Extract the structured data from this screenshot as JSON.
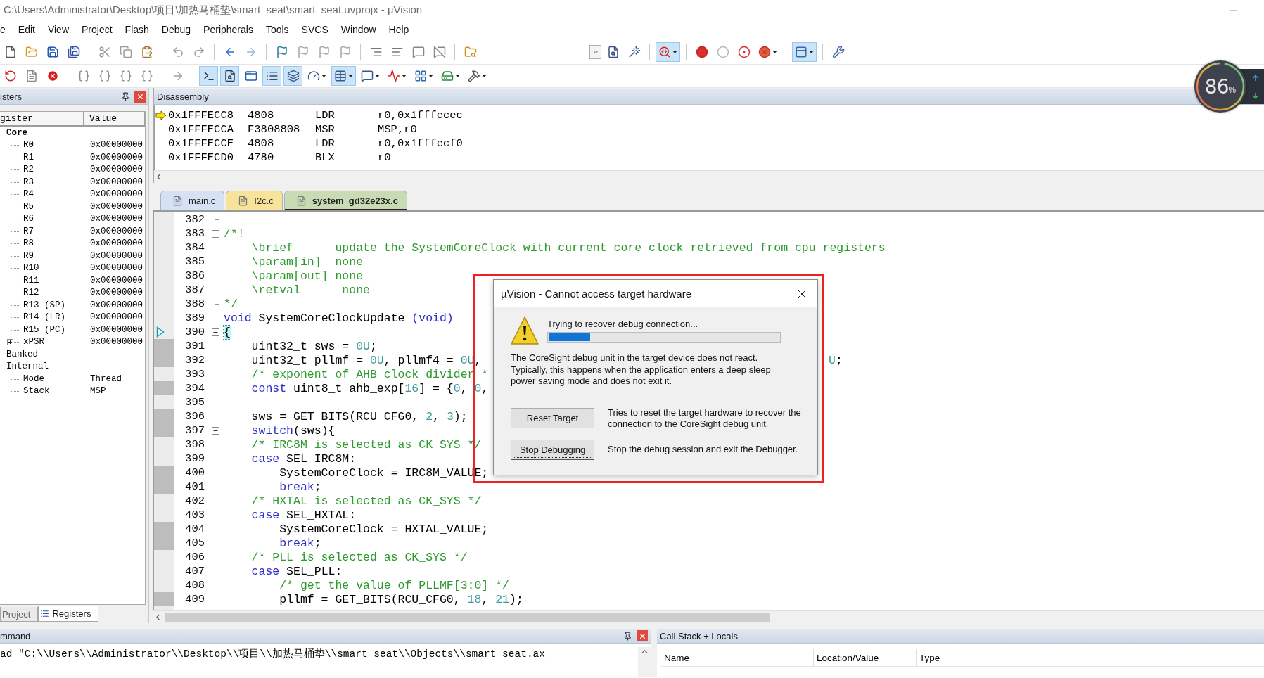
{
  "window": {
    "title": "C:\\Users\\Administrator\\Desktop\\项目\\加热马桶垫\\smart_seat\\smart_seat.uvprojx - µVision"
  },
  "menu": [
    "e",
    "Edit",
    "View",
    "Project",
    "Flash",
    "Debug",
    "Peripherals",
    "Tools",
    "SVCS",
    "Window",
    "Help"
  ],
  "toolbars": [
    {
      "items": [
        {
          "kind": "new",
          "pressed": false,
          "dropdown": false
        },
        {
          "kind": "open",
          "pressed": false,
          "dropdown": false
        },
        {
          "kind": "save",
          "pressed": false,
          "dropdown": false
        },
        {
          "kind": "save-all",
          "pressed": false,
          "dropdown": false
        },
        {
          "kind": "separator"
        },
        {
          "kind": "cut",
          "pressed": false,
          "dropdown": false
        },
        {
          "kind": "copy",
          "pressed": false,
          "dropdown": false
        },
        {
          "kind": "paste",
          "pressed": false,
          "dropdown": false
        },
        {
          "kind": "separator"
        },
        {
          "kind": "undo",
          "pressed": false,
          "dropdown": false
        },
        {
          "kind": "redo",
          "pressed": false,
          "dropdown": false
        },
        {
          "kind": "separator"
        },
        {
          "kind": "back",
          "pressed": false,
          "dropdown": false
        },
        {
          "kind": "forward",
          "pressed": false,
          "dropdown": false
        },
        {
          "kind": "separator"
        },
        {
          "kind": "bookmark",
          "pressed": false,
          "dropdown": false
        },
        {
          "kind": "bookmark-prev",
          "pressed": false,
          "dropdown": false
        },
        {
          "kind": "bookmark-next",
          "pressed": false,
          "dropdown": false
        },
        {
          "kind": "bookmark-clear",
          "pressed": false,
          "dropdown": false
        },
        {
          "kind": "separator"
        },
        {
          "kind": "indent",
          "pressed": false,
          "dropdown": false
        },
        {
          "kind": "outdent",
          "pressed": false,
          "dropdown": false
        },
        {
          "kind": "comment",
          "pressed": false,
          "dropdown": false
        },
        {
          "kind": "uncomment",
          "pressed": false,
          "dropdown": false
        },
        {
          "kind": "separator"
        },
        {
          "kind": "find-in-files",
          "pressed": false,
          "dropdown": false
        },
        {
          "kind": "spacer"
        },
        {
          "kind": "select-box"
        },
        {
          "kind": "find",
          "pressed": false,
          "dropdown": false
        },
        {
          "kind": "wand",
          "pressed": false,
          "dropdown": false
        },
        {
          "kind": "separator"
        },
        {
          "kind": "debug",
          "pressed": true,
          "dropdown": true
        },
        {
          "kind": "separator"
        },
        {
          "kind": "breakpoint",
          "pressed": false,
          "dropdown": false
        },
        {
          "kind": "breakpoint-off",
          "pressed": false,
          "dropdown": false
        },
        {
          "kind": "breakpoints-off",
          "pressed": false,
          "dropdown": false
        },
        {
          "kind": "breakpoints-kill",
          "pressed": false,
          "dropdown": true
        },
        {
          "kind": "separator"
        },
        {
          "kind": "window",
          "pressed": true,
          "dropdown": true
        },
        {
          "kind": "separator"
        },
        {
          "kind": "configure",
          "pressed": false,
          "dropdown": false
        }
      ]
    },
    {
      "items": [
        {
          "kind": "reset",
          "pressed": false,
          "dropdown": false
        },
        {
          "kind": "document",
          "pressed": false,
          "dropdown": false
        },
        {
          "kind": "stop",
          "pressed": false,
          "dropdown": false
        },
        {
          "kind": "separator"
        },
        {
          "kind": "step-into",
          "pressed": false,
          "dropdown": false
        },
        {
          "kind": "step-over",
          "pressed": false,
          "dropdown": false
        },
        {
          "kind": "step-out",
          "pressed": false,
          "dropdown": false
        },
        {
          "kind": "run-to-cursor",
          "pressed": false,
          "dropdown": false
        },
        {
          "kind": "separator"
        },
        {
          "kind": "next-statement",
          "pressed": false,
          "dropdown": false
        },
        {
          "kind": "separator"
        },
        {
          "kind": "command-window",
          "pressed": true,
          "dropdown": false
        },
        {
          "kind": "disassembly-window",
          "pressed": true,
          "dropdown": false
        },
        {
          "kind": "symbols-window",
          "pressed": false,
          "dropdown": false
        },
        {
          "kind": "registers-window",
          "pressed": true,
          "dropdown": false
        },
        {
          "kind": "call-stack-window",
          "pressed": true,
          "dropdown": false
        },
        {
          "kind": "watch-window",
          "pressed": false,
          "dropdown": true
        },
        {
          "kind": "memory-window",
          "pressed": true,
          "dropdown": true
        },
        {
          "kind": "serial-window",
          "pressed": false,
          "dropdown": true
        },
        {
          "kind": "analysis-window",
          "pressed": false,
          "dropdown": true
        },
        {
          "kind": "trace-window",
          "pressed": false,
          "dropdown": true
        },
        {
          "kind": "system-viewer",
          "pressed": false,
          "dropdown": true
        },
        {
          "kind": "toolbox",
          "pressed": false,
          "dropdown": true
        }
      ]
    }
  ],
  "registers": {
    "title": "isters",
    "columns": [
      "gister",
      "Value"
    ],
    "tree": [
      {
        "name": "Core",
        "emphasis": true,
        "children": [
          {
            "name": "R0",
            "value": "0x00000000"
          },
          {
            "name": "R1",
            "value": "0x00000000"
          },
          {
            "name": "R2",
            "value": "0x00000000"
          },
          {
            "name": "R3",
            "value": "0x00000000"
          },
          {
            "name": "R4",
            "value": "0x00000000"
          },
          {
            "name": "R5",
            "value": "0x00000000"
          },
          {
            "name": "R6",
            "value": "0x00000000"
          },
          {
            "name": "R7",
            "value": "0x00000000"
          },
          {
            "name": "R8",
            "value": "0x00000000"
          },
          {
            "name": "R9",
            "value": "0x00000000"
          },
          {
            "name": "R10",
            "value": "0x00000000"
          },
          {
            "name": "R11",
            "value": "0x00000000"
          },
          {
            "name": "R12",
            "value": "0x00000000"
          },
          {
            "name": "R13 (SP)",
            "value": "0x00000000"
          },
          {
            "name": "R14 (LR)",
            "value": "0x00000000"
          },
          {
            "name": "R15 (PC)",
            "value": "0x00000000"
          },
          {
            "name": "xPSR",
            "value": "0x00000000",
            "expanded": false
          }
        ]
      },
      {
        "name": "Banked",
        "emphasis": false
      },
      {
        "name": "Internal",
        "emphasis": false,
        "children": [
          {
            "name": "Mode",
            "value": "Thread"
          },
          {
            "name": "Stack",
            "value": "MSP"
          }
        ]
      }
    ]
  },
  "left_tabs": [
    {
      "label": "Project",
      "selected": false
    },
    {
      "label": "Registers",
      "selected": true
    }
  ],
  "disassembly": {
    "title": "Disassembly",
    "lines": [
      {
        "address": "0x1FFFECC8",
        "opcode": "4808",
        "mnemonic": "LDR",
        "operands": "r0,0x1fffecec",
        "current": true
      },
      {
        "address": "0x1FFFECCA",
        "opcode": "F3808808",
        "mnemonic": "MSR",
        "operands": "MSP,r0",
        "current": false
      },
      {
        "address": "0x1FFFECCE",
        "opcode": "4808",
        "mnemonic": "LDR",
        "operands": "r0,0x1fffecf0",
        "current": false
      },
      {
        "address": "0x1FFFECD0",
        "opcode": "4780",
        "mnemonic": "BLX",
        "operands": "r0",
        "current": false
      }
    ]
  },
  "editor_tabs": [
    {
      "label": "main.c",
      "selected": false,
      "color": "#d6e2f3"
    },
    {
      "label": "I2c.c",
      "selected": false,
      "color": "#f7e39a"
    },
    {
      "label": "system_gd32e23x.c",
      "selected": true,
      "color": "#c9dbb5"
    }
  ],
  "code": [
    {
      "n": "382",
      "fold_start": false,
      "fold_end": true,
      "executable": false,
      "current": false
    },
    {
      "n": "383",
      "fold_start": true,
      "fold_end": false,
      "executable": false,
      "current": false,
      "segs": [
        {
          "kind": "comment",
          "text": "/*!"
        }
      ]
    },
    {
      "n": "384",
      "fold_start": false,
      "fold_end": false,
      "executable": false,
      "current": false,
      "segs": [
        {
          "kind": "comment",
          "text": "    \\brief      update the SystemCoreClock with current core clock retrieved from cpu registers"
        }
      ]
    },
    {
      "n": "385",
      "fold_start": false,
      "fold_end": false,
      "executable": false,
      "current": false,
      "segs": [
        {
          "kind": "comment",
          "text": "    \\param[in]  none"
        }
      ]
    },
    {
      "n": "386",
      "fold_start": false,
      "fold_end": false,
      "executable": false,
      "current": false,
      "segs": [
        {
          "kind": "comment",
          "text": "    \\param[out] none"
        }
      ]
    },
    {
      "n": "387",
      "fold_start": false,
      "fold_end": false,
      "executable": false,
      "current": false,
      "segs": [
        {
          "kind": "comment",
          "text": "    \\retval      none"
        }
      ]
    },
    {
      "n": "388",
      "fold_start": false,
      "fold_end": true,
      "executable": false,
      "current": false,
      "segs": [
        {
          "kind": "comment",
          "text": "*/"
        }
      ]
    },
    {
      "n": "389",
      "fold_start": false,
      "fold_end": false,
      "executable": false,
      "current": false,
      "segs": [
        {
          "kind": "keyword",
          "text": "void"
        },
        {
          "kind": "plain",
          "text": " SystemCoreClockUpdate "
        },
        {
          "kind": "keyword",
          "text": "(void)"
        }
      ]
    },
    {
      "n": "390",
      "fold_start": true,
      "fold_end": false,
      "executable": false,
      "current": true,
      "segs": [
        {
          "kind": "match",
          "text": "{"
        }
      ]
    },
    {
      "n": "391",
      "fold_start": false,
      "fold_end": false,
      "executable": true,
      "current": false,
      "segs": [
        {
          "kind": "plain",
          "text": "    uint32_t sws = "
        },
        {
          "kind": "number",
          "text": "0U"
        },
        {
          "kind": "plain",
          "text": ";"
        }
      ]
    },
    {
      "n": "392",
      "fold_start": false,
      "fold_end": false,
      "executable": true,
      "current": false,
      "segs": [
        {
          "kind": "plain",
          "text": "    uint32_t pllmf = "
        },
        {
          "kind": "number",
          "text": "0U"
        },
        {
          "kind": "plain",
          "text": ", pllmf4 = "
        },
        {
          "kind": "number",
          "text": "0U"
        },
        {
          "kind": "plain",
          "text": ","
        }
      ],
      "tail": [
        {
          "kind": "number",
          "text": "U"
        },
        {
          "kind": "plain",
          "text": ";"
        }
      ]
    },
    {
      "n": "393",
      "fold_start": false,
      "fold_end": false,
      "executable": false,
      "current": false,
      "segs": [
        {
          "kind": "comment",
          "text": "    /* exponent of AHB clock divider *"
        }
      ]
    },
    {
      "n": "394",
      "fold_start": false,
      "fold_end": false,
      "executable": true,
      "current": false,
      "segs": [
        {
          "kind": "keyword",
          "text": "    const"
        },
        {
          "kind": "plain",
          "text": " uint8_t ahb_exp["
        },
        {
          "kind": "number",
          "text": "16"
        },
        {
          "kind": "plain",
          "text": "] = {"
        },
        {
          "kind": "number",
          "text": "0"
        },
        {
          "kind": "plain",
          "text": ", "
        },
        {
          "kind": "number",
          "text": "0"
        },
        {
          "kind": "plain",
          "text": ","
        }
      ]
    },
    {
      "n": "395",
      "fold_start": false,
      "fold_end": false,
      "executable": false,
      "current": false
    },
    {
      "n": "396",
      "fold_start": false,
      "fold_end": false,
      "executable": true,
      "current": false,
      "segs": [
        {
          "kind": "plain",
          "text": "    sws = GET_BITS(RCU_CFG0, "
        },
        {
          "kind": "number",
          "text": "2"
        },
        {
          "kind": "plain",
          "text": ", "
        },
        {
          "kind": "number",
          "text": "3"
        },
        {
          "kind": "plain",
          "text": ");"
        }
      ]
    },
    {
      "n": "397",
      "fold_start": true,
      "fold_end": false,
      "executable": true,
      "current": false,
      "segs": [
        {
          "kind": "keyword",
          "text": "    switch"
        },
        {
          "kind": "plain",
          "text": "(sws){"
        }
      ]
    },
    {
      "n": "398",
      "fold_start": false,
      "fold_end": false,
      "executable": false,
      "current": false,
      "segs": [
        {
          "kind": "comment",
          "text": "    /* IRC8M is selected as CK_SYS */"
        }
      ]
    },
    {
      "n": "399",
      "fold_start": false,
      "fold_end": false,
      "executable": false,
      "current": false,
      "segs": [
        {
          "kind": "keyword",
          "text": "    case"
        },
        {
          "kind": "plain",
          "text": " SEL_IRC8M:"
        }
      ]
    },
    {
      "n": "400",
      "fold_start": false,
      "fold_end": false,
      "executable": true,
      "current": false,
      "segs": [
        {
          "kind": "plain",
          "text": "        SystemCoreClock = IRC8M_VALUE;"
        }
      ]
    },
    {
      "n": "401",
      "fold_start": false,
      "fold_end": false,
      "executable": true,
      "current": false,
      "segs": [
        {
          "kind": "keyword",
          "text": "        break"
        },
        {
          "kind": "plain",
          "text": ";"
        }
      ]
    },
    {
      "n": "402",
      "fold_start": false,
      "fold_end": false,
      "executable": false,
      "current": false,
      "segs": [
        {
          "kind": "comment",
          "text": "    /* HXTAL is selected as CK_SYS */"
        }
      ]
    },
    {
      "n": "403",
      "fold_start": false,
      "fold_end": false,
      "executable": false,
      "current": false,
      "segs": [
        {
          "kind": "keyword",
          "text": "    case"
        },
        {
          "kind": "plain",
          "text": " SEL_HXTAL:"
        }
      ]
    },
    {
      "n": "404",
      "fold_start": false,
      "fold_end": false,
      "executable": true,
      "current": false,
      "segs": [
        {
          "kind": "plain",
          "text": "        SystemCoreClock = HXTAL_VALUE;"
        }
      ]
    },
    {
      "n": "405",
      "fold_start": false,
      "fold_end": false,
      "executable": true,
      "current": false,
      "segs": [
        {
          "kind": "keyword",
          "text": "        break"
        },
        {
          "kind": "plain",
          "text": ";"
        }
      ]
    },
    {
      "n": "406",
      "fold_start": false,
      "fold_end": false,
      "executable": false,
      "current": false,
      "segs": [
        {
          "kind": "comment",
          "text": "    /* PLL is selected as CK_SYS */"
        }
      ]
    },
    {
      "n": "407",
      "fold_start": false,
      "fold_end": false,
      "executable": false,
      "current": false,
      "segs": [
        {
          "kind": "keyword",
          "text": "    case"
        },
        {
          "kind": "plain",
          "text": " SEL_PLL:"
        }
      ]
    },
    {
      "n": "408",
      "fold_start": false,
      "fold_end": false,
      "executable": false,
      "current": false,
      "segs": [
        {
          "kind": "comment",
          "text": "        /* get the value of PLLMF[3:0] */"
        }
      ]
    },
    {
      "n": "409",
      "fold_start": false,
      "fold_end": false,
      "executable": true,
      "current": false,
      "segs": [
        {
          "kind": "plain",
          "text": "        pllmf = GET_BITS(RCU_CFG0, "
        },
        {
          "kind": "number",
          "text": "18"
        },
        {
          "kind": "plain",
          "text": ", "
        },
        {
          "kind": "number",
          "text": "21"
        },
        {
          "kind": "plain",
          "text": ");"
        }
      ]
    }
  ],
  "command": {
    "title": "mmand",
    "line": "ad \"C:\\\\Users\\\\Administrator\\\\Desktop\\\\项目\\\\加热马桶垫\\\\smart_seat\\\\Objects\\\\smart_seat.ax"
  },
  "call_stack": {
    "title": "Call Stack + Locals",
    "columns": [
      "Name",
      "Location/Value",
      "Type"
    ]
  },
  "cpu_meter": {
    "reading": "86",
    "unit": "%"
  },
  "dialog": {
    "title": "µVision - Cannot access target hardware",
    "status": "Trying to recover debug connection...",
    "progress": {
      "level": 0.18
    },
    "message": "The CoreSight debug unit in the target device does not react.\nTypically, this happens when the application enters a deep sleep power saving mode and does not exit it.",
    "actions": [
      {
        "label": "Reset Target",
        "focused": false,
        "description": "Tries to reset the target hardware to recover the connection to the CoreSight debug unit."
      },
      {
        "label": "Stop Debugging",
        "focused": true,
        "description": "Stop the debug session and exit the Debugger."
      }
    ]
  }
}
